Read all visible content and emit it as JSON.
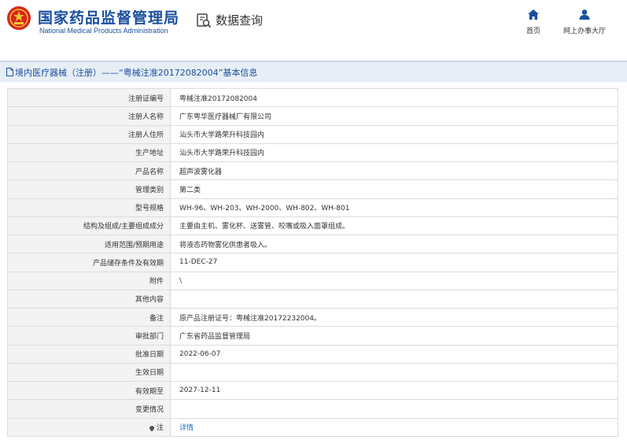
{
  "header": {
    "org_cn": "国家药品监督管理局",
    "org_en": "National Medical Products Administration",
    "search_title": "数据查询",
    "nav": {
      "home": "首页",
      "hall": "网上办事大厅"
    }
  },
  "title_bar": {
    "text": "境内医疗器械（注册）——“粤械注准20172082004”基本信息"
  },
  "rows": [
    {
      "label": "注册证编号",
      "value": "粤械注准20172082004"
    },
    {
      "label": "注册人名称",
      "value": "广东粤华医疗器械厂有限公司"
    },
    {
      "label": "注册人住所",
      "value": "汕头市大学路荣升科技园内"
    },
    {
      "label": "生产地址",
      "value": "汕头市大学路荣升科技园内"
    },
    {
      "label": "产品名称",
      "value": "超声波雾化器"
    },
    {
      "label": "管理类别",
      "value": "第二类"
    },
    {
      "label": "型号规格",
      "value": "WH-96、WH-203、WH-2000、WH-802、WH-801"
    },
    {
      "label": "结构及组成/主要组成成分",
      "value": "主要由主机、雾化杯、送雾管、咬嘴或吸入面罩组成。"
    },
    {
      "label": "适用范围/预期用途",
      "value": "将液态药物雾化供患者吸入。"
    },
    {
      "label": "产品储存条件及有效期",
      "value": "11-DEC-27"
    },
    {
      "label": "附件",
      "value": "\\"
    },
    {
      "label": "其他内容",
      "value": ""
    },
    {
      "label": "备注",
      "value": "原产品注册证号：粤械注准20172232004。"
    },
    {
      "label": "审批部门",
      "value": "广东省药品监督管理局"
    },
    {
      "label": "批准日期",
      "value": "2022-06-07"
    },
    {
      "label": "生效日期",
      "value": ""
    },
    {
      "label": "有效期至",
      "value": "2027-12-11"
    },
    {
      "label": "变更情况",
      "value": ""
    }
  ],
  "note_row": {
    "label": "注",
    "link": "详情"
  },
  "colors": {
    "brand_blue": "#1a4fa0",
    "link": "#1a6fc8",
    "title_bg": "#e8eef6"
  }
}
